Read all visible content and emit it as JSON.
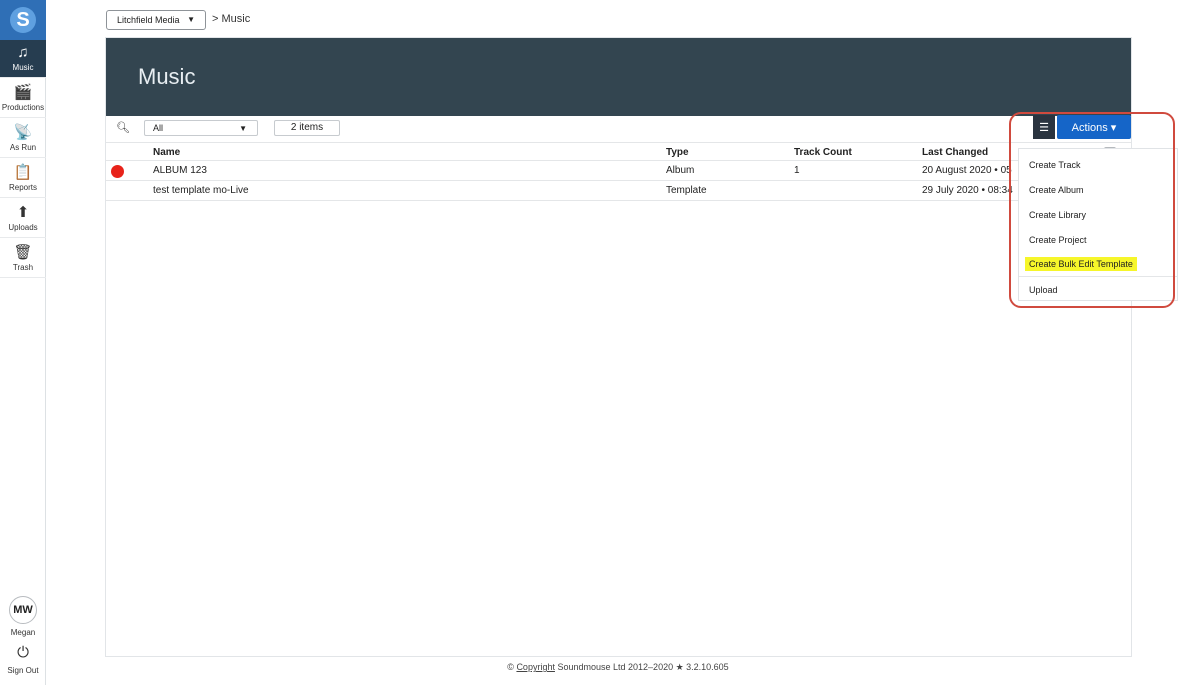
{
  "sidebar": {
    "logo_letter": "S",
    "items": [
      {
        "label": "Music",
        "icon": "♫"
      },
      {
        "label": "Productions",
        "icon": "🎬"
      },
      {
        "label": "As Run",
        "icon": "📡"
      },
      {
        "label": "Reports",
        "icon": "📋"
      },
      {
        "label": "Uploads",
        "icon": "⬆"
      },
      {
        "label": "Trash",
        "icon": "🗑"
      }
    ],
    "user_initials": "MW",
    "user_name": "Megan",
    "sign_out_label": "Sign Out",
    "sign_out_icon": "⏻"
  },
  "breadcrumb": {
    "org_select": "Litchfield Media",
    "separator_text": "> Music"
  },
  "page": {
    "title": "Music"
  },
  "toolbar": {
    "filter_value": "All",
    "item_count": "2 items"
  },
  "table": {
    "headers": {
      "name": "Name",
      "type": "Type",
      "track_count": "Track Count",
      "last_changed": "Last Changed"
    },
    "rows": [
      {
        "name": "ALBUM 123",
        "type": "Album",
        "track_count": "1",
        "last_changed": "20 August 2020 • 05",
        "status_color": "#e8231a"
      },
      {
        "name": "test template mo-Live",
        "type": "Template",
        "track_count": "",
        "last_changed": "29 July 2020 • 08:34"
      }
    ]
  },
  "actions": {
    "button_label": "Actions ▾",
    "menu": [
      "Create Track",
      "Create Album",
      "Create Library",
      "Create Project",
      "Create Bulk Edit Template",
      "Upload"
    ],
    "highlighted_item": "Create Bulk Edit Template"
  },
  "footer": {
    "prefix": "©",
    "link": "Copyright",
    "rest": "Soundmouse Ltd 2012–2020 ★ 3.2.10.605"
  },
  "colors": {
    "nav_active": "#263d50",
    "header_bg": "#334550",
    "actions_blue": "#1565c8",
    "highlight": "#f6f62a",
    "callout": "#d04a3e"
  }
}
